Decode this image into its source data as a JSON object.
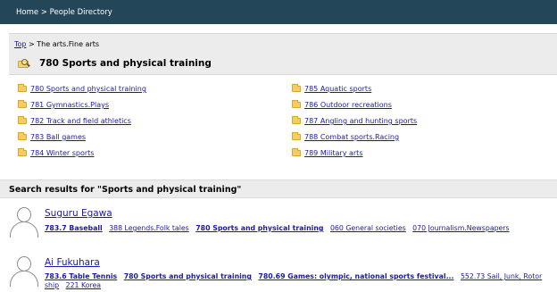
{
  "breadcrumb": {
    "home": "Home",
    "separator": ">",
    "current": "People Directory"
  },
  "category_path": {
    "top": "Top",
    "separator": ">",
    "rest": "The arts.Fine arts"
  },
  "category_title": "780 Sports and physical training",
  "subcategories": [
    "780 Sports and physical training",
    "781 Gymnastics.Plays",
    "782 Track and field athletics",
    "783 Ball games",
    "784 Winter sports",
    "785 Aquatic sports",
    "786 Outdoor recreations",
    "787 Angling and hunting sports",
    "788 Combat sports.Racing",
    "789 Military arts"
  ],
  "results_heading": "Search results for \"Sports and physical training\"",
  "people": [
    {
      "name": "Suguru Egawa",
      "tags": [
        "783.7 Baseball",
        "388 Legends.Folk tales",
        "780 Sports and physical training",
        "060 General societies",
        "070 Journalism.Newspapers"
      ]
    },
    {
      "name": "Ai Fukuhara",
      "tags": [
        "783.6 Table Tennis",
        "780 Sports and physical training",
        "780.69 Games: olympic, national sports festival...",
        "552.73 Sail, Junk, Rotor ship",
        "221 Korea"
      ]
    }
  ],
  "colors": {
    "header_bg": "#234758",
    "link": "#1a1aa6",
    "panel_bg": "#ececec",
    "folder": "#f5cd63"
  },
  "icons": {
    "folder": "folder-icon",
    "category": "folder-search-icon",
    "avatar": "avatar-placeholder-icon"
  }
}
